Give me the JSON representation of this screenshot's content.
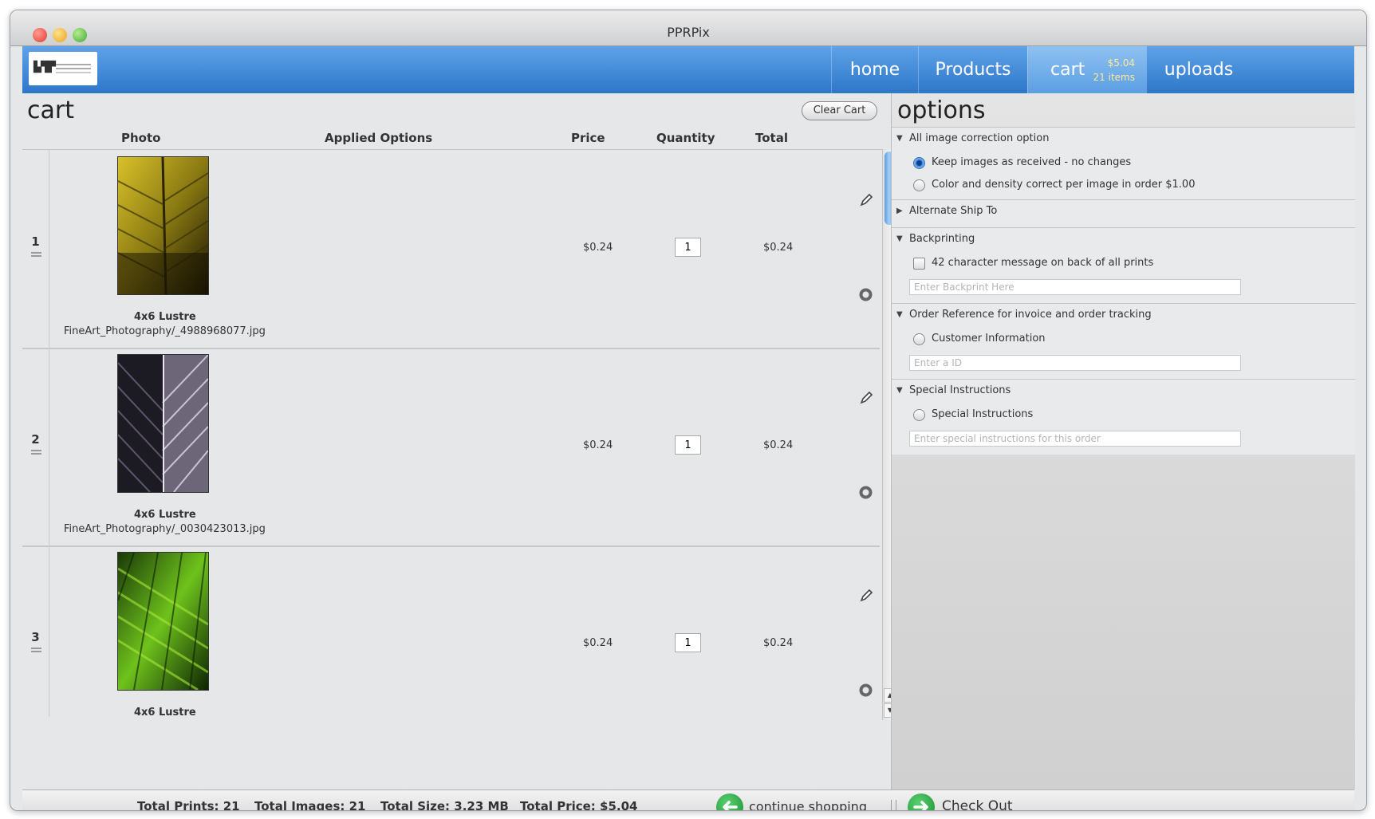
{
  "window": {
    "title": "PPRPix"
  },
  "nav": {
    "items": [
      {
        "label": "home"
      },
      {
        "label": "Products"
      },
      {
        "label": "cart"
      },
      {
        "label": "uploads"
      }
    ],
    "cart_price": "$5.04",
    "cart_items": "21 items"
  },
  "cart": {
    "heading": "cart",
    "clear_label": "Clear Cart",
    "columns": [
      "Photo",
      "Applied Options",
      "Price",
      "Quantity",
      "Total"
    ],
    "rows": [
      {
        "number": "1",
        "size": "4x6 Lustre",
        "file": "FineArt_Photography/_4988968077.jpg",
        "price": "$0.24",
        "quantity": "1",
        "total": "$0.24",
        "image": "yellow-leaf-photo"
      },
      {
        "number": "2",
        "size": "4x6 Lustre",
        "file": "FineArt_Photography/_0030423013.jpg",
        "price": "$0.24",
        "quantity": "1",
        "total": "$0.24",
        "image": "purple-leaf-photo"
      },
      {
        "number": "3",
        "size": "4x6 Lustre",
        "file": "",
        "price": "$0.24",
        "quantity": "1",
        "total": "$0.24",
        "image": "green-leaf-photo"
      }
    ]
  },
  "footer": {
    "total_prints": "Total Prints: 21",
    "total_images": "Total Images: 21",
    "total_size": "Total Size: 3.23 MB",
    "total_price": "Total Price: $5.04",
    "continue_label": "continue shopping",
    "checkout_label": "Check Out"
  },
  "options": {
    "heading": "options",
    "sections": {
      "image_correction": {
        "title": "All image correction option",
        "opt1": "Keep images as received - no changes",
        "opt2": "Color and density correct per image in order $1.00"
      },
      "alternate_ship": {
        "title": "Alternate Ship To"
      },
      "backprinting": {
        "title": "Backprinting",
        "checkbox": "42 character message on back of all prints",
        "placeholder": "Enter Backprint Here"
      },
      "order_reference": {
        "title": "Order Reference for invoice and order tracking",
        "radio": "Customer Information",
        "placeholder": "Enter a ID"
      },
      "special": {
        "title": "Special Instructions",
        "radio": "Special Instructions",
        "placeholder": "Enter special instructions for this order"
      }
    }
  },
  "colors": {
    "nav_blue": "#3b84d6",
    "go_green": "#23a03e",
    "panel_gray": "#e6e7e8"
  }
}
